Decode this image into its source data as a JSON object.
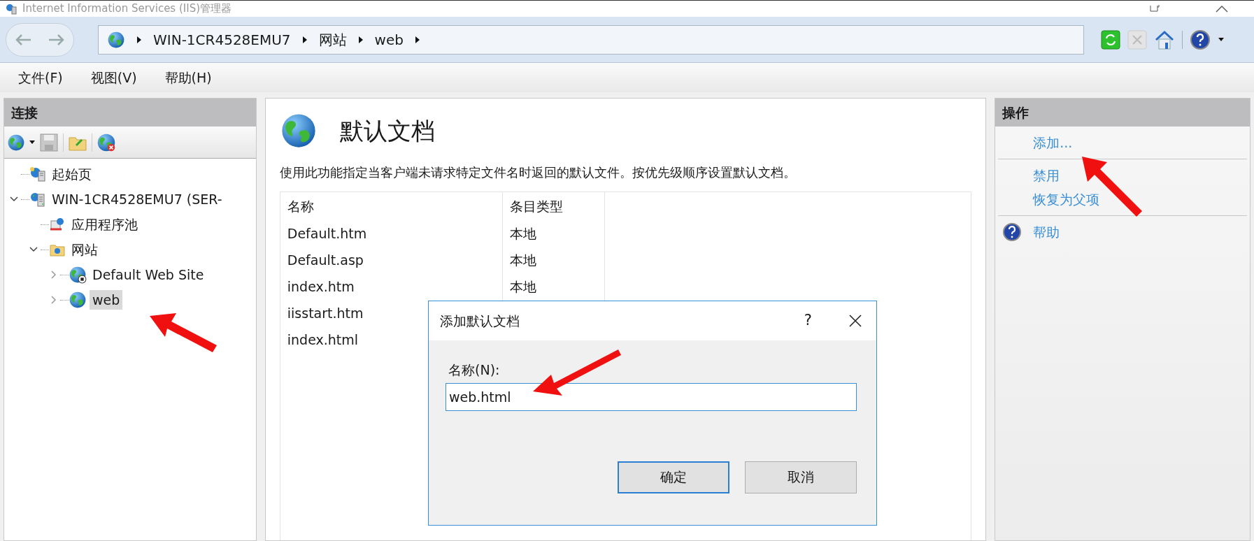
{
  "window": {
    "title": "Internet Information Services (IIS)管理器"
  },
  "address_bar": {
    "path": [
      "WIN-1CR4528EMU7",
      "网站",
      "web"
    ]
  },
  "menu": [
    "文件(F)",
    "视图(V)",
    "帮助(H)"
  ],
  "connections": {
    "title": "连接",
    "tree": [
      {
        "label": "起始页",
        "kind": "start",
        "selected": false
      },
      {
        "label": "WIN-1CR4528EMU7 (SER-",
        "kind": "server",
        "expanded": true,
        "selected": false,
        "children": [
          {
            "label": "应用程序池",
            "kind": "pool",
            "selected": false
          },
          {
            "label": "网站",
            "kind": "sites",
            "expanded": true,
            "selected": false,
            "children": [
              {
                "label": "Default Web Site",
                "kind": "site_stopped",
                "expanded": false,
                "selected": false
              },
              {
                "label": "web",
                "kind": "site",
                "expanded": false,
                "selected": true
              }
            ]
          }
        ]
      }
    ]
  },
  "feature": {
    "title": "默认文档",
    "description": "使用此功能指定当客户端未请求特定文件名时返回的默认文件。按优先级顺序设置默认文档。",
    "columns": [
      "名称",
      "条目类型"
    ],
    "rows": [
      {
        "name": "Default.htm",
        "type": "本地"
      },
      {
        "name": "Default.asp",
        "type": "本地"
      },
      {
        "name": "index.htm",
        "type": "本地"
      },
      {
        "name": "iisstart.htm"
      },
      {
        "name": "index.html"
      }
    ]
  },
  "actions": {
    "title": "操作",
    "groups": [
      [
        {
          "label": "添加...",
          "kind": "link"
        }
      ],
      [
        {
          "label": "禁用",
          "kind": "link"
        },
        {
          "label": "恢复为父项",
          "kind": "link"
        }
      ],
      [
        {
          "label": "帮助",
          "kind": "help"
        }
      ]
    ]
  },
  "dialog": {
    "title": "添加默认文档",
    "help": "?",
    "field_label": "名称(N):",
    "value": "web.html",
    "buttons": [
      {
        "label": "确定",
        "default": true
      },
      {
        "label": "取消",
        "default": false
      }
    ]
  }
}
